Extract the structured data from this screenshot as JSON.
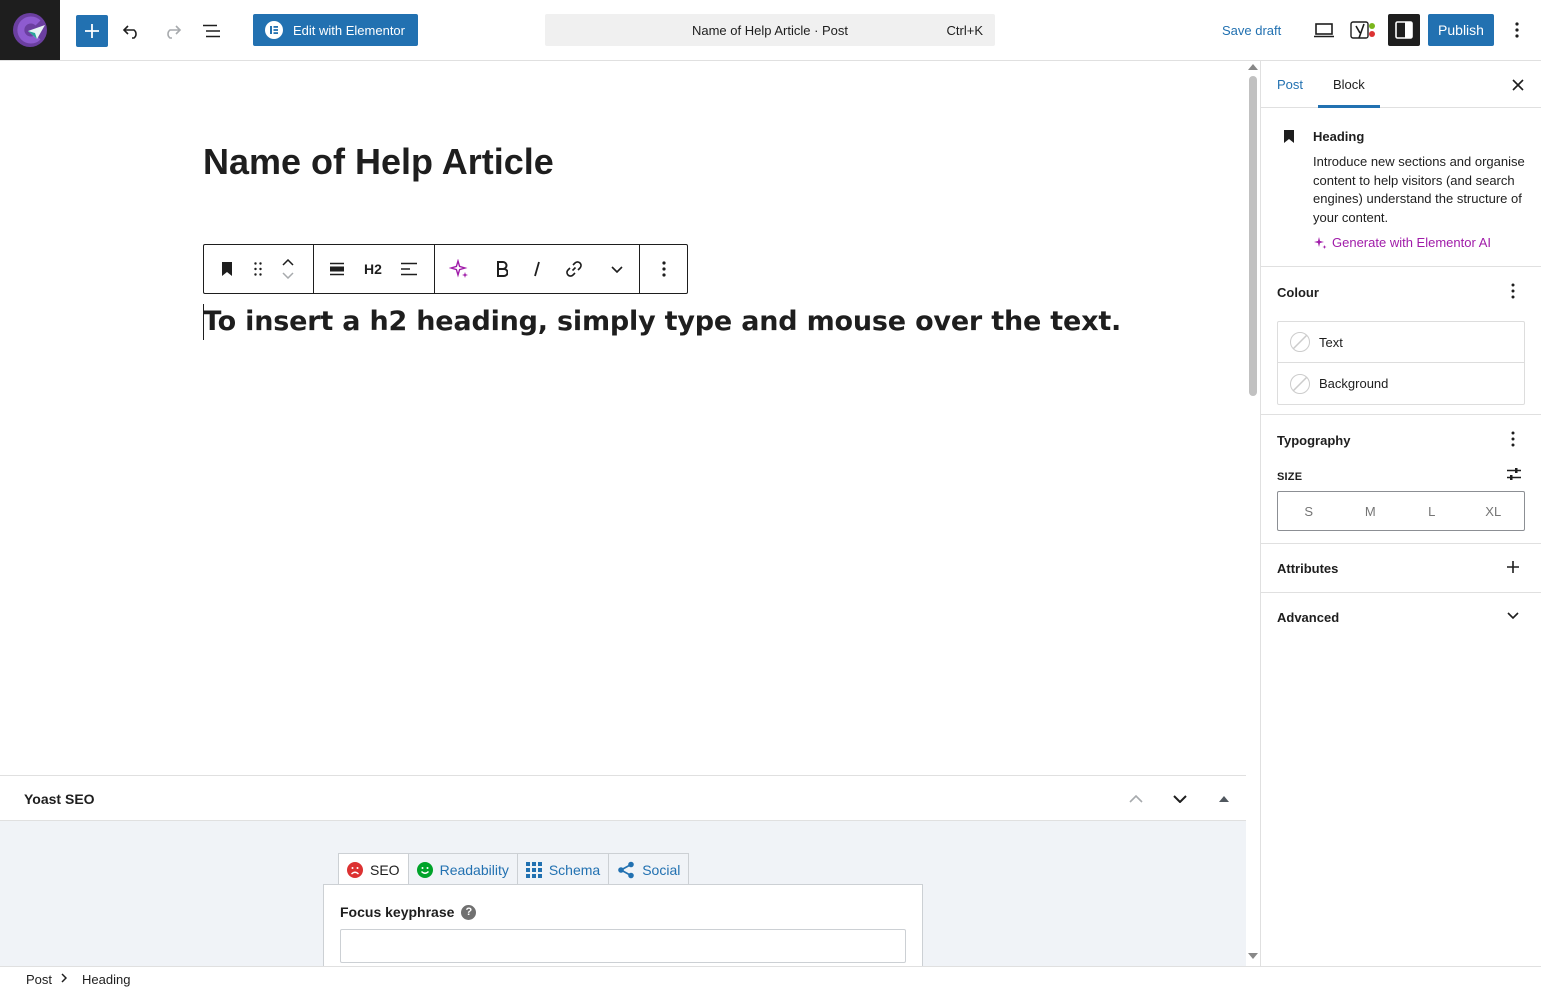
{
  "topbar": {
    "elementor_label": "Edit with Elementor",
    "command_title": "Name of Help Article · Post",
    "command_shortcut": "Ctrl+K",
    "save_draft": "Save draft",
    "publish": "Publish",
    "icons": [
      "site-logo-icon",
      "add-block-icon",
      "undo-icon",
      "redo-icon",
      "document-overview-icon",
      "elementor-icon",
      "preview-device-icon",
      "yoast-icon",
      "settings-sidebar-icon",
      "options-icon"
    ]
  },
  "editor": {
    "post_title": "Name of Help Article",
    "heading_text": "To insert a h2 heading, simply type and mouse over the text.",
    "toolbar": {
      "heading_level": "H2"
    }
  },
  "yoast": {
    "title": "Yoast SEO",
    "tabs": [
      {
        "label": "SEO",
        "status": "bad"
      },
      {
        "label": "Readability",
        "status": "good"
      },
      {
        "label": "Schema"
      },
      {
        "label": "Social"
      }
    ],
    "focus_keyphrase_label": "Focus keyphrase",
    "focus_keyphrase_value": ""
  },
  "breadcrumb": {
    "items": [
      "Post",
      "Heading"
    ]
  },
  "sidebar": {
    "tabs": [
      "Post",
      "Block"
    ],
    "active_tab": "Block",
    "block": {
      "title": "Heading",
      "description": "Introduce new sections and organise content to help visitors (and search engines) understand the structure of your content.",
      "ai_link": "Generate with Elementor AI"
    },
    "colour": {
      "title": "Colour",
      "items": [
        "Text",
        "Background"
      ]
    },
    "typography": {
      "title": "Typography",
      "size_label": "SIZE",
      "sizes": [
        "S",
        "M",
        "L",
        "XL"
      ]
    },
    "attributes_title": "Attributes",
    "advanced_title": "Advanced"
  },
  "colors": {
    "accent": "#2271b1",
    "ai_purple": "#a01ca9",
    "seo_bad": "#dc3232",
    "readability_good": "#00a32a"
  }
}
